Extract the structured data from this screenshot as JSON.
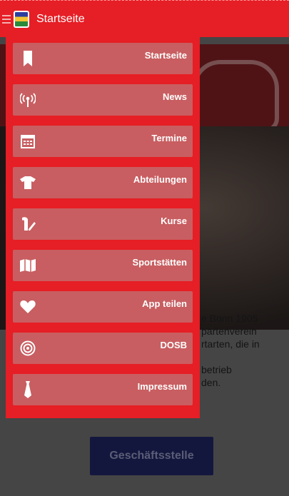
{
  "appbar": {
    "title": "Startseite",
    "colors": {
      "primary": "#e61e25"
    }
  },
  "drawer": {
    "items": [
      {
        "label": "Startseite",
        "icon": "bookmark-icon"
      },
      {
        "label": "News",
        "icon": "antenna-icon"
      },
      {
        "label": "Termine",
        "icon": "calendar-icon"
      },
      {
        "label": "Abteilungen",
        "icon": "shirt-icon"
      },
      {
        "label": "Kurse",
        "icon": "whistle-icon"
      },
      {
        "label": "Sportstätten",
        "icon": "map-icon"
      },
      {
        "label": "App teilen",
        "icon": "heart-icon"
      },
      {
        "label": "DOSB",
        "icon": "target-icon"
      },
      {
        "label": "Impressum",
        "icon": "tie-icon"
      }
    ]
  },
  "content": {
    "intro_lines": [
      "e Bonn 1905",
      "partenverein",
      "rtarten, die in",
      "",
      "betrieb",
      "den."
    ],
    "office_button": "Geschäftsstelle"
  }
}
